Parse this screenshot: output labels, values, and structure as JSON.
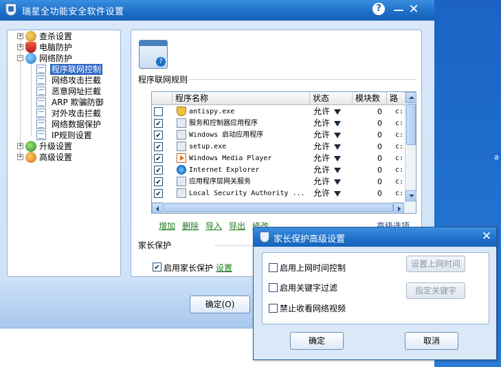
{
  "window": {
    "title": "瑞星全功能安全软件设置",
    "help_label": "?",
    "minimize_label": "—",
    "close_label": "✕"
  },
  "tree": {
    "items": [
      {
        "label": "查杀设置"
      },
      {
        "label": "电脑防护"
      },
      {
        "label": "网络防护"
      },
      {
        "label": "程序联网控制"
      },
      {
        "label": "网络攻击拦截"
      },
      {
        "label": "恶意网址拦截"
      },
      {
        "label": "ARP 欺骗防御"
      },
      {
        "label": "对外攻击拦截"
      },
      {
        "label": "网络数据保护"
      },
      {
        "label": "IP规则设置"
      },
      {
        "label": "升级设置"
      },
      {
        "label": "高级设置"
      }
    ],
    "selected": "程序联网控制"
  },
  "rules_section": {
    "title": "程序联网规则",
    "columns": [
      "程序名称",
      "状态",
      "模块数",
      "路"
    ],
    "rows": [
      {
        "checked": false,
        "name": "antispy.exe",
        "icon": "shield-app-icon",
        "status": "允许",
        "modules": "0",
        "path": "c:"
      },
      {
        "checked": true,
        "name": "服务和控制器应用程序",
        "icon": "app-window-icon",
        "status": "允许",
        "modules": "0",
        "path": "c:"
      },
      {
        "checked": true,
        "name": "Windows 启动应用程序",
        "icon": "app-window-icon",
        "status": "允许",
        "modules": "0",
        "path": "c:"
      },
      {
        "checked": true,
        "name": "setup.exe",
        "icon": "app-window-icon",
        "status": "允许",
        "modules": "0",
        "path": "c:"
      },
      {
        "checked": true,
        "name": "Windows Media Player",
        "icon": "media-player-icon",
        "status": "允许",
        "modules": "0",
        "path": "c:"
      },
      {
        "checked": true,
        "name": "Internet Explorer",
        "icon": "ie-icon",
        "status": "允许",
        "modules": "0",
        "path": "c:"
      },
      {
        "checked": true,
        "name": "应用程序层网关服务",
        "icon": "app-window-icon",
        "status": "允许",
        "modules": "0",
        "path": "c:"
      },
      {
        "checked": true,
        "name": "Local Security Authority ...",
        "icon": "app-window-icon",
        "status": "允许",
        "modules": "0",
        "path": "c:"
      }
    ],
    "actions": [
      "增加",
      "删除",
      "导入",
      "导出",
      "修改"
    ],
    "advanced_label": "高级选项"
  },
  "parent_control": {
    "title": "家长保护",
    "enable_label": "启用家长保护",
    "enabled": true,
    "settings_link": "设置"
  },
  "main_buttons": {
    "ok_label": "确定(O)"
  },
  "dialog": {
    "title": "家长保护高级设置",
    "close_label": "✕",
    "options": [
      {
        "label": "启用上网时间控制",
        "checked": false
      },
      {
        "label": "启用关键字过滤",
        "checked": false
      },
      {
        "label": "禁止收看网络视频",
        "checked": false
      }
    ],
    "set_time_label": "设置上网时间",
    "set_keywords_label": "指定关键字",
    "ok_label": "确定",
    "cancel_label": "取消"
  },
  "desktop": {
    "edge_text": "a"
  },
  "colors": {
    "titlebar": "#1e70c9",
    "selection": "#3169c6",
    "link_green": "#1a7a1a"
  }
}
